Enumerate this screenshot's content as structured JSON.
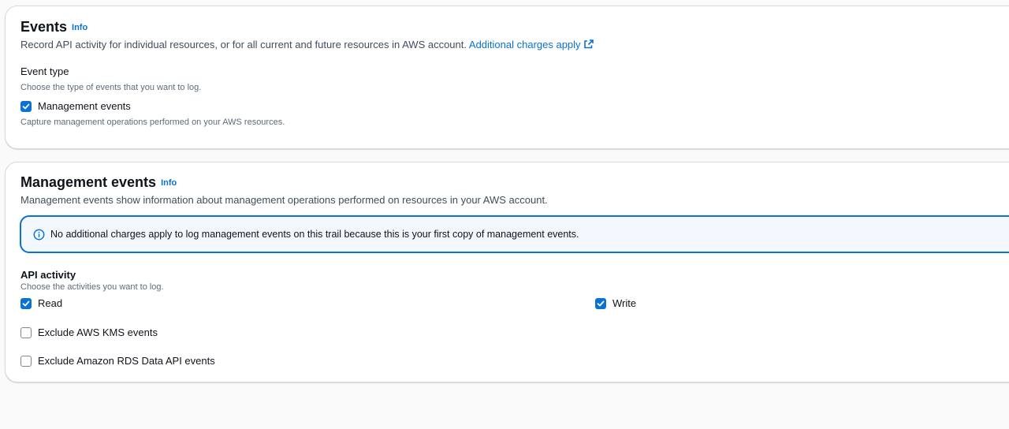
{
  "events_section": {
    "title": "Events",
    "info_label": "Info",
    "description": "Record API activity for individual resources, or for all current and future resources in AWS account.",
    "charges_link": "Additional charges apply",
    "event_type": {
      "label": "Event type",
      "hint": "Choose the type of events that you want to log.",
      "options": [
        {
          "label": "Management events",
          "checked": true,
          "description": "Capture management operations performed on your AWS resources."
        }
      ]
    }
  },
  "management_section": {
    "title": "Management events",
    "info_label": "Info",
    "description": "Management events show information about management operations performed on resources in your AWS account.",
    "alert": {
      "icon": "info-circle-icon",
      "text": "No additional charges apply to log management events on this trail because this is your first copy of management events."
    },
    "api_activity": {
      "label": "API activity",
      "hint": "Choose the activities you want to log.",
      "read": {
        "label": "Read",
        "checked": true
      },
      "write": {
        "label": "Write",
        "checked": true
      }
    },
    "exclusions": [
      {
        "label": "Exclude AWS KMS events",
        "checked": false
      },
      {
        "label": "Exclude Amazon RDS Data API events",
        "checked": false
      }
    ]
  },
  "colors": {
    "accent": "#0972d3",
    "alert_background": "#f2f8fd",
    "border": "#d5dbdb"
  }
}
